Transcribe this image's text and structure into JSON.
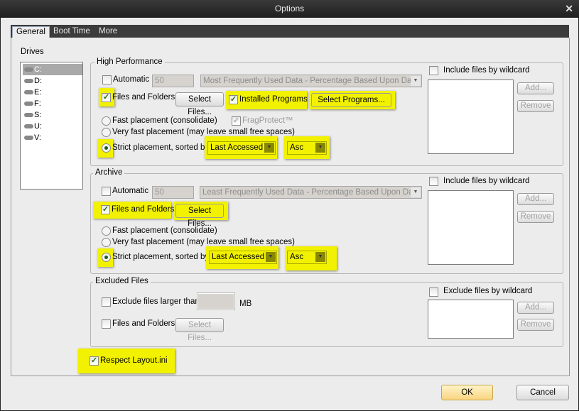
{
  "window": {
    "title": "Options",
    "close": "✕"
  },
  "tabs": [
    "General",
    "Boot Time",
    "More"
  ],
  "drives": {
    "label": "Drives",
    "items": [
      "C:",
      "D:",
      "E:",
      "F:",
      "S:",
      "U:",
      "V:"
    ],
    "selected": "C:"
  },
  "high_performance": {
    "title": "High Performance",
    "automatic": "Automatic",
    "percent": "50",
    "mode": "Most Frequently Used Data - Percentage Based Upon Data",
    "files_folders": "Files and Folders",
    "select_files": "Select Files...",
    "installed_programs": "Installed Programs",
    "select_programs": "Select Programs...",
    "fast": "Fast placement (consolidate)",
    "fragprotect": "FragProtect™",
    "very_fast": "Very fast placement (may leave small free spaces)",
    "strict": "Strict placement, sorted by",
    "sort_by": "Last Accessed",
    "order": "Asc",
    "wildcard": "Include files by wildcard",
    "add": "Add...",
    "remove": "Remove"
  },
  "archive": {
    "title": "Archive",
    "automatic": "Automatic",
    "percent": "50",
    "mode": "Least Frequently Used Data - Percentage Based Upon Data",
    "files_folders": "Files and Folders",
    "select_files": "Select Files...",
    "fast": "Fast placement (consolidate)",
    "very_fast": "Very fast placement (may leave small free spaces)",
    "strict": "Strict placement, sorted by",
    "sort_by": "Last Accessed",
    "order": "Asc",
    "wildcard": "Include files by wildcard",
    "add": "Add...",
    "remove": "Remove"
  },
  "excluded": {
    "title": "Excluded Files",
    "larger_than": "Exclude files larger than",
    "size_value": "",
    "unit": "MB",
    "files_folders": "Files and Folders",
    "select_files": "Select Files...",
    "wildcard": "Exclude files by wildcard",
    "add": "Add...",
    "remove": "Remove"
  },
  "respect_layout": "Respect Layout.ini",
  "buttons": {
    "ok": "OK",
    "cancel": "Cancel"
  },
  "highlight_color": "#f2f200"
}
